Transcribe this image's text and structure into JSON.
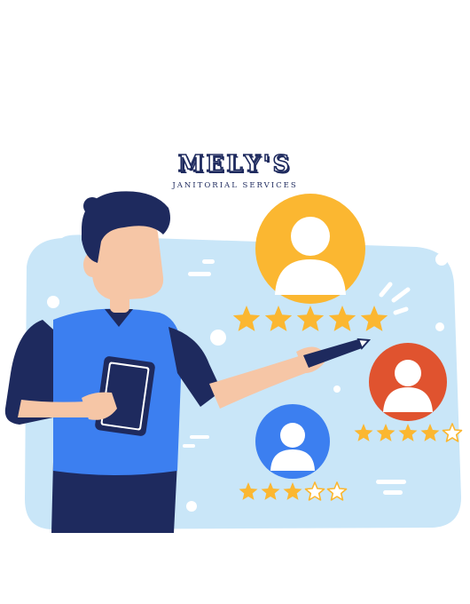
{
  "logo": {
    "wordmark": "MELY'S",
    "tagline": "JANITORIAL SERVICES"
  },
  "ratings": [
    {
      "name": "yellow-profile",
      "stars": 5,
      "max": 5,
      "color": "#fbb731"
    },
    {
      "name": "orange-profile",
      "stars": 4,
      "max": 5,
      "color": "#e0532f"
    },
    {
      "name": "blue-profile",
      "stars": 3,
      "max": 5,
      "color": "#3c7ff0"
    }
  ],
  "colors": {
    "panel": "#c9e6f8",
    "navy": "#1e2a5e",
    "shirt": "#3c7ff0",
    "skin": "#f6c6a6",
    "star": "#fbb731"
  }
}
